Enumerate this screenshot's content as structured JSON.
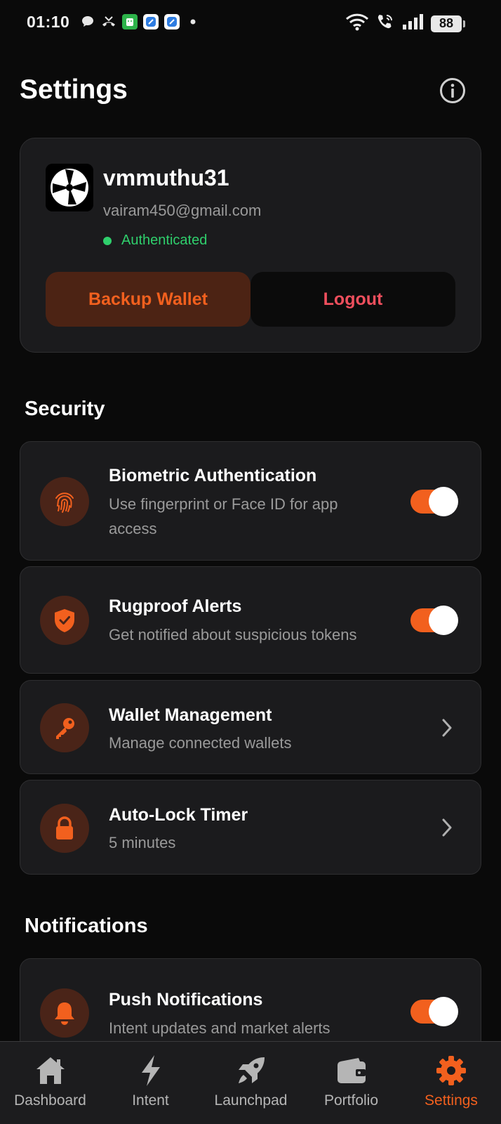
{
  "status_bar": {
    "time": "01:10",
    "battery": "88"
  },
  "page": {
    "title": "Settings"
  },
  "profile": {
    "username": "vmmuthu31",
    "email": "vairam450@gmail.com",
    "status": "Authenticated",
    "backup_label": "Backup Wallet",
    "logout_label": "Logout"
  },
  "security": {
    "title": "Security",
    "items": [
      {
        "title": "Biometric Authentication",
        "subtitle": "Use fingerprint or Face ID for app access",
        "control": "toggle",
        "on": true,
        "icon": "fingerprint-icon"
      },
      {
        "title": "Rugproof Alerts",
        "subtitle": "Get notified about suspicious tokens",
        "control": "toggle",
        "on": true,
        "icon": "shield-check-icon"
      },
      {
        "title": "Wallet Management",
        "subtitle": "Manage connected wallets",
        "control": "chevron",
        "icon": "key-icon"
      },
      {
        "title": "Auto-Lock Timer",
        "subtitle": "5 minutes",
        "control": "chevron",
        "icon": "lock-icon"
      }
    ]
  },
  "notifications": {
    "title": "Notifications",
    "items": [
      {
        "title": "Push Notifications",
        "subtitle": "Intent updates and market alerts",
        "control": "toggle",
        "on": true,
        "icon": "bell-icon"
      }
    ]
  },
  "nav": {
    "items": [
      {
        "label": "Dashboard",
        "icon": "home-icon"
      },
      {
        "label": "Intent",
        "icon": "lightning-icon"
      },
      {
        "label": "Launchpad",
        "icon": "rocket-icon"
      },
      {
        "label": "Portfolio",
        "icon": "wallet-icon"
      },
      {
        "label": "Settings",
        "icon": "gear-icon",
        "active": true
      }
    ]
  },
  "colors": {
    "accent": "#f2601e",
    "success": "#2fcf6c",
    "danger": "#ee4f5d",
    "card": "#1b1b1d",
    "background": "#0a0a0a"
  }
}
